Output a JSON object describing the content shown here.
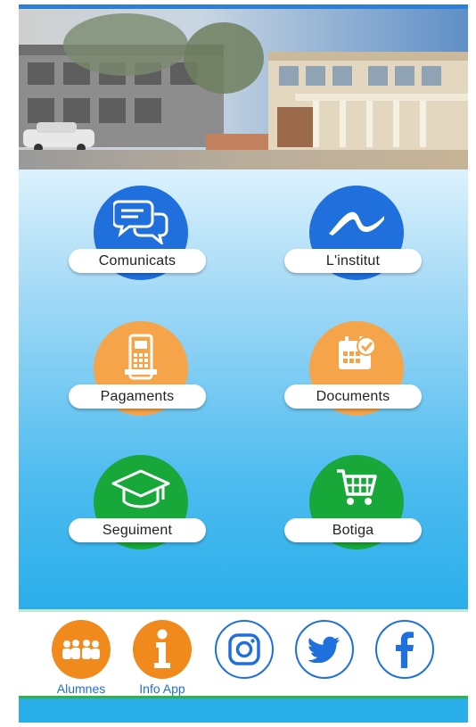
{
  "menu": {
    "comunicats": "Comunicats",
    "institut": "L'institut",
    "pagaments": "Pagaments",
    "documents": "Documents",
    "seguiment": "Seguiment",
    "botiga": "Botiga"
  },
  "bottom": {
    "alumnes": "Alumnes",
    "info_app": "Info App"
  },
  "icons": {
    "comunicats": "chat-bubbles-icon",
    "institut": "wave-logo-icon",
    "pagaments": "card-terminal-icon",
    "documents": "calendar-check-icon",
    "seguiment": "graduation-cap-icon",
    "botiga": "shopping-cart-icon",
    "alumnes": "students-group-icon",
    "info_app": "info-icon",
    "instagram": "instagram-icon",
    "twitter": "twitter-icon",
    "facebook": "facebook-icon"
  },
  "colors": {
    "blue": "#1f6fdc",
    "orange": "#f6a44a",
    "green": "#18a83a",
    "sky": "#2aaeea"
  }
}
